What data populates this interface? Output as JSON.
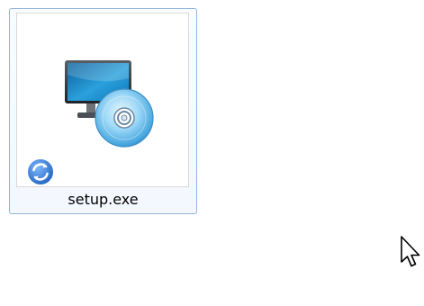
{
  "desktop": {
    "files": [
      {
        "name": "setup.exe",
        "icon": "monitor-cd-icon",
        "overlay_icon": "sync-icon",
        "selected": true
      }
    ]
  },
  "cursor": {
    "icon": "arrow-cursor-icon"
  },
  "colors": {
    "selection_border": "#8eb4df",
    "selection_fill": "#f3f8fe",
    "monitor_blue": "#1f8fcd",
    "disc_blue": "#7ac4ef",
    "badge_blue": "#2e74c9"
  }
}
